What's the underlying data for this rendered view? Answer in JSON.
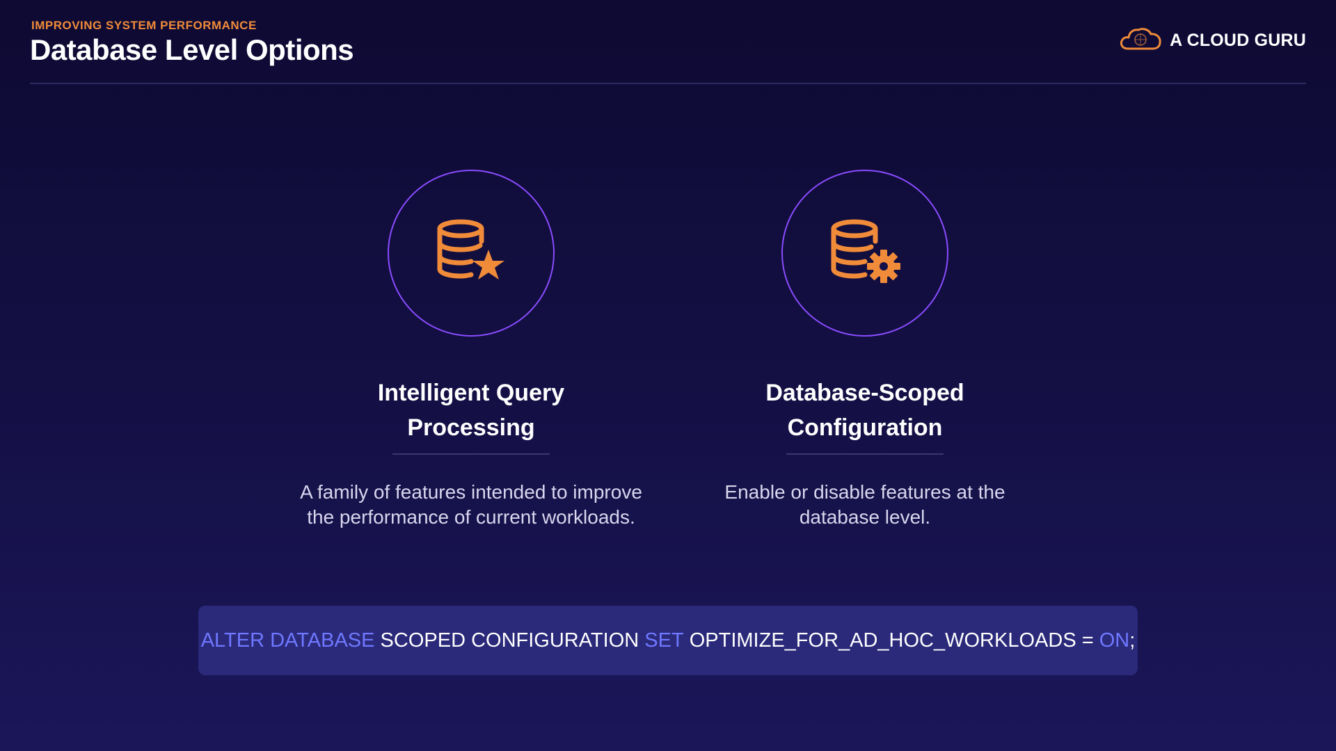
{
  "header": {
    "eyebrow": "IMPROVING SYSTEM PERFORMANCE",
    "title": "Database Level Options",
    "brand": "A CLOUD GURU"
  },
  "cards": [
    {
      "icon": "database-star-icon",
      "title_line1": "Intelligent Query",
      "title_line2": "Processing",
      "description": "A family of features intended to improve the performance of current workloads."
    },
    {
      "icon": "database-gear-icon",
      "title_line1": "Database-Scoped",
      "title_line2": "Configuration",
      "description": "Enable or disable features at the database level."
    }
  ],
  "code": {
    "kw1": "ALTER DATABASE",
    "t1": " SCOPED CONFIGURATION ",
    "kw2": "SET",
    "t2": " OPTIMIZE_FOR_AD_HOC_WORKLOADS = ",
    "kw3": "ON",
    "t3": ";"
  },
  "colors": {
    "accent_orange": "#f08b3a",
    "circle_purple": "#8a4cff",
    "keyword_blue": "#6f78ff",
    "code_bg": "#2b2a7a"
  }
}
